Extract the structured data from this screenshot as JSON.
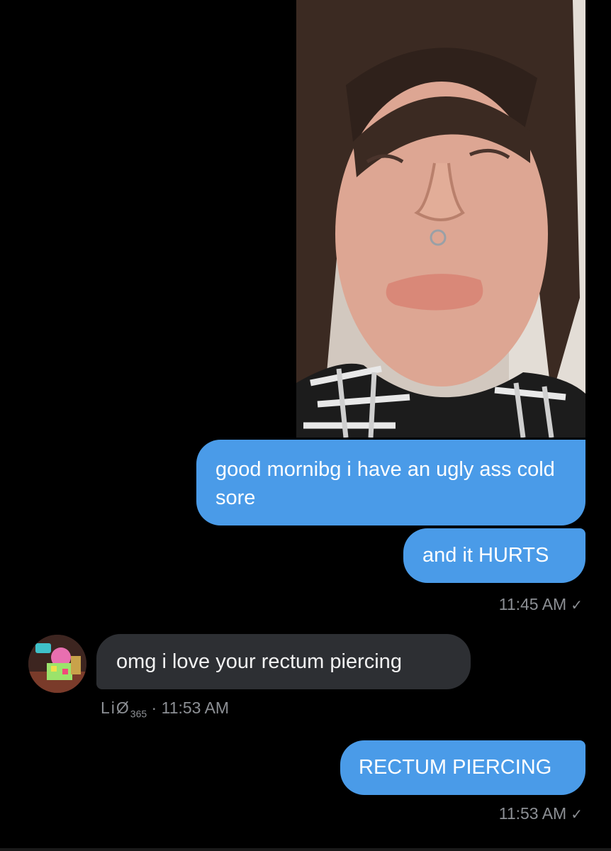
{
  "messages": [
    {
      "kind": "image",
      "direction": "sent"
    },
    {
      "kind": "text",
      "direction": "sent",
      "text": "good mornibg i have an ugly ass cold sore"
    },
    {
      "kind": "text",
      "direction": "sent",
      "text": "and it HURTS"
    },
    {
      "kind": "text",
      "direction": "received",
      "text": "omg i love your rectum piercing"
    },
    {
      "kind": "text",
      "direction": "sent",
      "text": "RECTUM PIERCING"
    }
  ],
  "receipts": {
    "first": {
      "time": "11:45 AM",
      "status_icon": "✓"
    },
    "second": {
      "time": "11:53 AM",
      "status_icon": "✓"
    }
  },
  "received_meta": {
    "sender_name": "LiØ",
    "sender_suffix": "365",
    "separator": "·",
    "time": "11:53 AM"
  },
  "colors": {
    "background": "#000000",
    "sent_bubble": "#4a9be8",
    "received_bubble": "#2d2f33",
    "meta_text": "#8c8f94"
  },
  "icons": {
    "read_receipt": "check-icon",
    "avatar": "contact-avatar"
  }
}
